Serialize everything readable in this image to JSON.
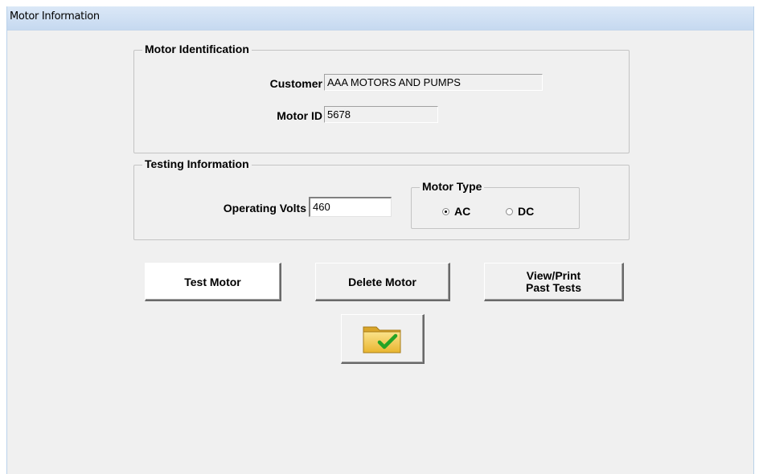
{
  "window": {
    "title": "Motor Information"
  },
  "motor_identification": {
    "legend": "Motor Identification",
    "customer_label": "Customer",
    "customer_value": "AAA MOTORS AND PUMPS",
    "motor_id_label": "Motor ID",
    "motor_id_value": "5678"
  },
  "testing_information": {
    "legend": "Testing Information",
    "volts_label": "Operating Volts",
    "volts_value": "460",
    "motor_type": {
      "legend": "Motor Type",
      "options": [
        {
          "label": "AC",
          "selected": true
        },
        {
          "label": "DC",
          "selected": false
        }
      ]
    }
  },
  "buttons": {
    "test_motor": "Test Motor",
    "delete_motor": "Delete Motor",
    "view_print_line1": "View/Print",
    "view_print_line2": "Past Tests",
    "open_folder_icon": "folder-check-icon"
  },
  "colors": {
    "folder": "#f3c84d",
    "check": "#2aa82a",
    "titlebar": "#c6d9f0"
  }
}
